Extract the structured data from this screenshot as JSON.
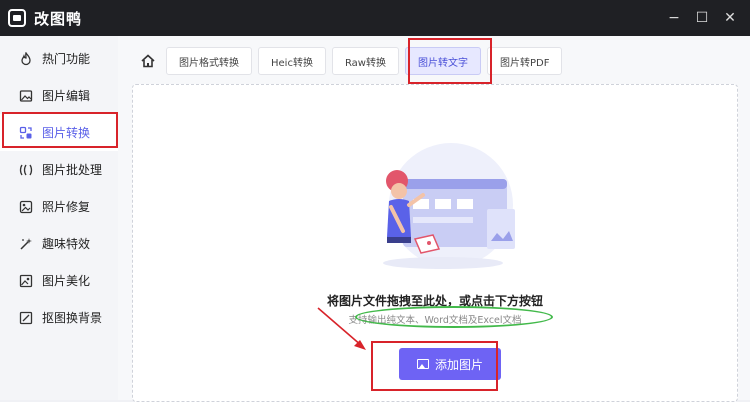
{
  "app": {
    "title": "改图鸭"
  },
  "window": {
    "minimize": "−",
    "maximize": "☐",
    "close": "✕"
  },
  "sidebar": {
    "items": [
      {
        "label": "热门功能",
        "icon": "flame-icon"
      },
      {
        "label": "图片编辑",
        "icon": "image-edit-icon"
      },
      {
        "label": "图片转换",
        "icon": "convert-icon",
        "active": true
      },
      {
        "label": "图片批处理",
        "icon": "batch-icon"
      },
      {
        "label": "照片修复",
        "icon": "photo-repair-icon"
      },
      {
        "label": "趣味特效",
        "icon": "magic-wand-icon"
      },
      {
        "label": "图片美化",
        "icon": "beautify-icon"
      },
      {
        "label": "抠图换背景",
        "icon": "cutout-icon"
      }
    ]
  },
  "tabs": [
    {
      "label": "图片格式转换"
    },
    {
      "label": "Heic转换"
    },
    {
      "label": "Raw转换"
    },
    {
      "label": "图片转文字",
      "active": true
    },
    {
      "label": "图片转PDF"
    }
  ],
  "upload": {
    "drop_text": "将图片文件拖拽至此处，或点击下方按钮",
    "hint_text": "支持输出纯文本、Word文档及Excel文档",
    "add_button": "添加图片"
  },
  "colors": {
    "accent": "#6e63f4",
    "highlight_red": "#d8232a",
    "highlight_green": "#42b94a"
  }
}
